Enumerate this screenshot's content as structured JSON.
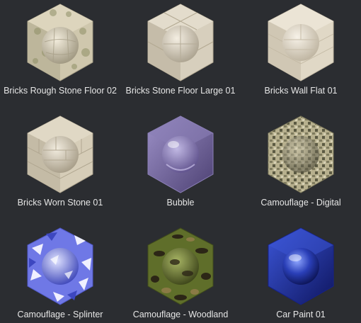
{
  "library": {
    "materials": [
      {
        "id": "bricks-rough-stone-floor-02",
        "name": "Bricks Rough Stone Floor 02",
        "icon": "brick-cube-icon",
        "colors": {
          "base": "#cfc7ad",
          "accent": "#8e8f66",
          "ball": "#d8d1bb"
        }
      },
      {
        "id": "bricks-stone-floor-large-01",
        "name": "Bricks Stone Floor Large 01",
        "icon": "brick-cube-icon",
        "colors": {
          "base": "#d7cfbd",
          "accent": "#b3a992",
          "ball": "#ddd6c6"
        }
      },
      {
        "id": "bricks-wall-flat-01",
        "name": "Bricks Wall Flat 01",
        "icon": "brick-cube-icon",
        "colors": {
          "base": "#e0d8c6",
          "accent": "#c2b8a3",
          "ball": "#e5ddcc"
        }
      },
      {
        "id": "bricks-worn-stone-01",
        "name": "Bricks Worn Stone 01",
        "icon": "brick-cube-icon",
        "colors": {
          "base": "#d6cdb8",
          "accent": "#aea48e",
          "ball": "#dcd4c2"
        }
      },
      {
        "id": "bubble",
        "name": "Bubble",
        "icon": "bubble-cube-icon",
        "colors": {
          "base": "#6a5b92",
          "accent": "#8b7fb6",
          "ball": "#7e70ab"
        }
      },
      {
        "id": "camouflage-digital",
        "name": "Camouflage - Digital",
        "icon": "camo-cube-icon",
        "colors": {
          "base": "#b7b08e",
          "accent": "#5c5a43",
          "ball": "#a8a281"
        }
      },
      {
        "id": "camouflage-splinter",
        "name": "Camouflage - Splinter",
        "icon": "camo-cube-icon",
        "colors": {
          "base": "#6f78e6",
          "accent": "#f0f0ff",
          "ball": "#7d86ec"
        }
      },
      {
        "id": "camouflage-woodland",
        "name": "Camouflage - Woodland",
        "icon": "camo-cube-icon",
        "colors": {
          "base": "#5f6e2a",
          "accent": "#2c2616",
          "ball": "#6d7a33"
        }
      },
      {
        "id": "car-paint-01",
        "name": "Car Paint 01",
        "icon": "paint-cube-icon",
        "colors": {
          "base": "#1e2c9e",
          "accent": "#3b55d6",
          "ball": "#2a3fb8"
        }
      }
    ]
  }
}
